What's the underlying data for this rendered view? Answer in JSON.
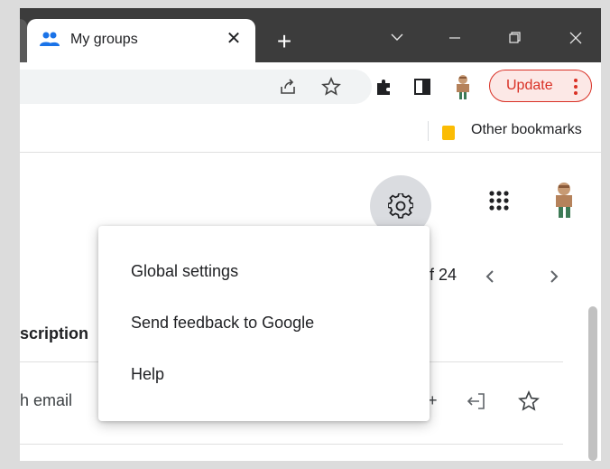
{
  "tab": {
    "title": "My groups",
    "close_glyph": "✕",
    "icon": "groups-icon"
  },
  "new_tab_glyph": "+",
  "window_controls": {
    "dropdown": "chevron-down-icon",
    "minimize": "minimize-icon",
    "restore": "restore-icon",
    "close": "close-icon"
  },
  "toolbar": {
    "share_icon": "share-icon",
    "star_icon": "star-icon",
    "extensions_icon": "puzzle-icon",
    "sidepanel_icon": "side-panel-icon",
    "update_label": "Update",
    "update_color": "#d93025"
  },
  "bookmarks": {
    "other_label": "Other bookmarks",
    "folder_color": "#fbbc04"
  },
  "header": {
    "settings_icon": "gear-icon",
    "apps_icon": "apps-grid-icon"
  },
  "pager": {
    "text": "f 24"
  },
  "table": {
    "column_header": "scription",
    "row_text": "h email",
    "row_plus": "+"
  },
  "menu": {
    "items": [
      {
        "label": "Global settings"
      },
      {
        "label": "Send feedback to Google"
      },
      {
        "label": "Help"
      }
    ]
  }
}
